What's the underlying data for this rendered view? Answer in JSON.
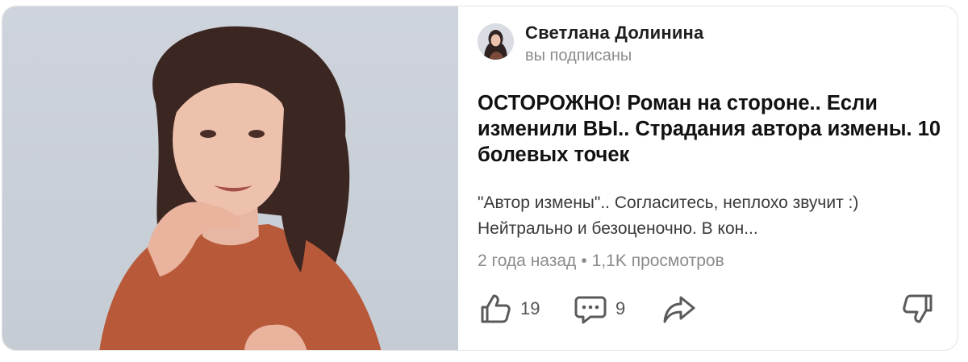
{
  "post": {
    "author": "Светлана Долинина",
    "subscription_status": "вы подписаны",
    "title": "ОСТОРОЖНО! Роман на стороне.. Если изменили ВЫ.. Страдания автора измены. 10 болевых точек",
    "snippet": "\"Автор измены\".. Согласитесь, неплохо звучит :) Нейтрально и безоценочно. В кон...",
    "time_ago": "2 года назад",
    "views": "1,1K просмотров",
    "separator": "•",
    "likes": "19",
    "comments": "9"
  },
  "icons": {
    "like": "thumbs-up-icon",
    "comment": "comment-bubble-icon",
    "share": "share-arrow-icon",
    "dislike": "thumbs-down-icon"
  },
  "colors": {
    "icon": "#5a5a5a",
    "photo_background": "#cfd4dc",
    "shirt": "#b8593a",
    "hair": "#3b2621"
  }
}
